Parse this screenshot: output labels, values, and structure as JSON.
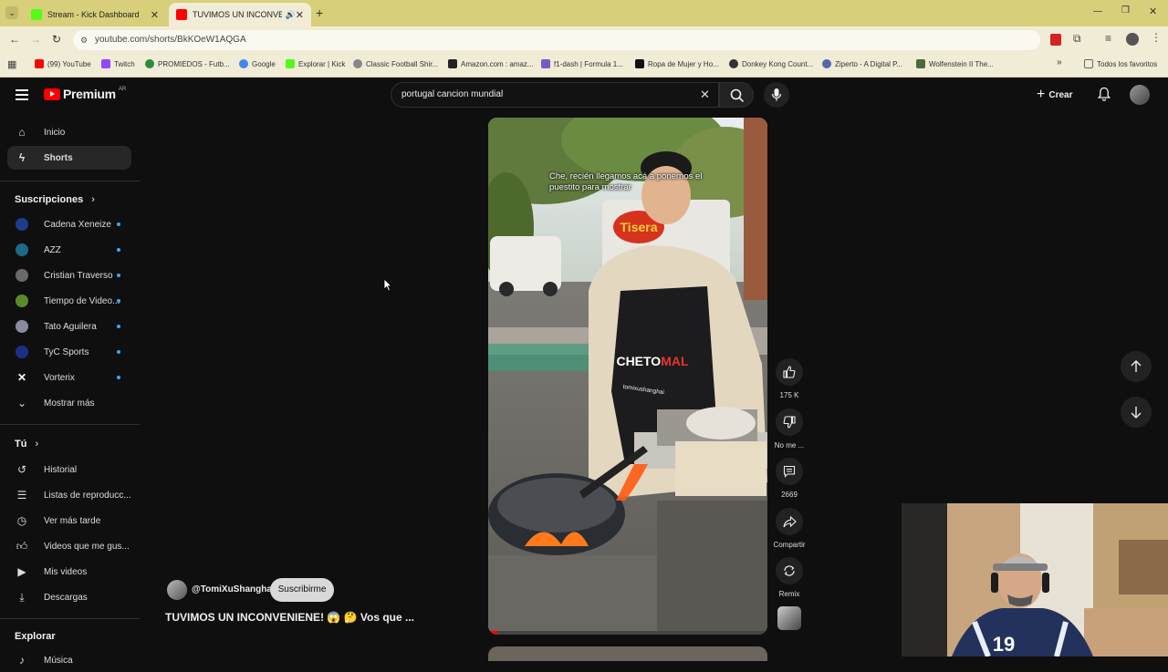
{
  "tabs": [
    {
      "title": "Stream - Kick Dashboard",
      "active": false
    },
    {
      "title": "TUVIMOS UN INCONVENI",
      "active": true
    }
  ],
  "address": "youtube.com/shorts/BkKOeW1AQGA",
  "bookmarks": [
    "(99) YouTube",
    "Twitch",
    "PROMIEDOS - Futb...",
    "Google",
    "Explorar | Kick",
    "Classic Football Shir...",
    "Amazon.com : amaz...",
    "f1-dash | Formula 1...",
    "Ropa de Mujer y Ho...",
    "Donkey Kong Count...",
    "Ziperto - A Digital P...",
    "Wolfenstein II The..."
  ],
  "bookmarks_more": "»",
  "all_bookmarks": "Todos los favoritos",
  "yt": {
    "logo": "Premium",
    "country": "AR",
    "search_value": "portugal cancion mundial",
    "create_label": "Crear"
  },
  "sidebar": {
    "main": [
      {
        "label": "Inicio"
      },
      {
        "label": "Shorts"
      }
    ],
    "subs_title": "Suscripciones",
    "subs": [
      {
        "label": "Cadena Xeneize",
        "color": "#1f3b8c"
      },
      {
        "label": "AZZ",
        "color": "#1a6a8a"
      },
      {
        "label": "Cristian Traverso",
        "color": "#6a6a6a"
      },
      {
        "label": "Tiempo de Video...",
        "color": "#5b8a2a"
      },
      {
        "label": "Tato Aguilera",
        "color": "#8a8aa0"
      },
      {
        "label": "TyC Sports",
        "color": "#1b2f8a"
      },
      {
        "label": "Vorterix",
        "color": "#ffffff"
      }
    ],
    "show_more": "Mostrar más",
    "you_title": "Tú",
    "you": [
      {
        "label": "Historial"
      },
      {
        "label": "Listas de reproducc..."
      },
      {
        "label": "Ver más tarde"
      },
      {
        "label": "Videos que me gus..."
      },
      {
        "label": "Mis videos"
      },
      {
        "label": "Descargas"
      }
    ],
    "explore_title": "Explorar",
    "explore_partial": "Música"
  },
  "short": {
    "subtitle_line1": "Che, recién llegamos acá a ponernos el",
    "subtitle_line2": "puestito para mostrar",
    "van_text": "Tisera",
    "apron_text1": "CHETO",
    "apron_text2": "MAL",
    "apron_text3": "tomixushanghai",
    "channel": "@TomiXuShanghai",
    "subscribe": "Suscribirme",
    "title": "TUVIMOS UN INCONVENIENE! 😱 🤔 Vos que ..."
  },
  "actions": {
    "likes": "175 K",
    "dislike": "No me ...",
    "comments": "2669",
    "share": "Compartir",
    "remix": "Remix"
  },
  "webcam": {
    "jersey_number": "19"
  }
}
